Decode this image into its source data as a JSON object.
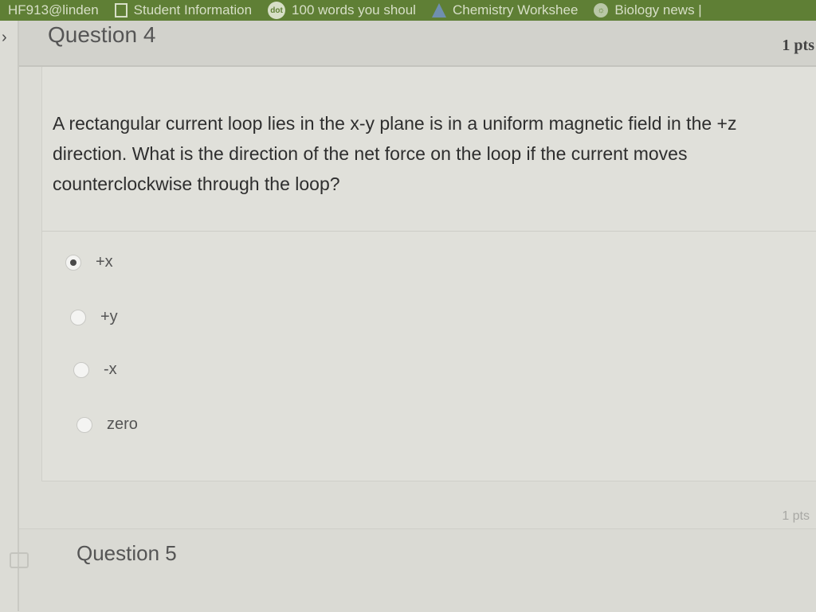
{
  "bookmarks": [
    {
      "label": "HF913@linden",
      "icon": "none"
    },
    {
      "label": "Student Information",
      "icon": "doc-icon"
    },
    {
      "label": "100 words you shoul",
      "icon": "dot-icon",
      "badge": "dot"
    },
    {
      "label": "Chemistry Workshee",
      "icon": "flask-icon"
    },
    {
      "label": "Biology news |",
      "icon": "globe-icon"
    }
  ],
  "question4": {
    "title": "Question 4",
    "points": "1 pts",
    "text": "A rectangular current loop lies in the x-y plane is in a uniform magnetic field in the +z direction. What is the direction of the net force on the loop if the current moves counterclockwise through the loop?",
    "answers": [
      {
        "label": "+x",
        "selected": true
      },
      {
        "label": "+y",
        "selected": false
      },
      {
        "label": "-x",
        "selected": false
      },
      {
        "label": "zero",
        "selected": false
      }
    ]
  },
  "question5": {
    "title": "Question 5",
    "points": "1 pts"
  },
  "colors": {
    "bookmark_bar": "#5f7f35",
    "page_bg": "#dcdcd6"
  }
}
